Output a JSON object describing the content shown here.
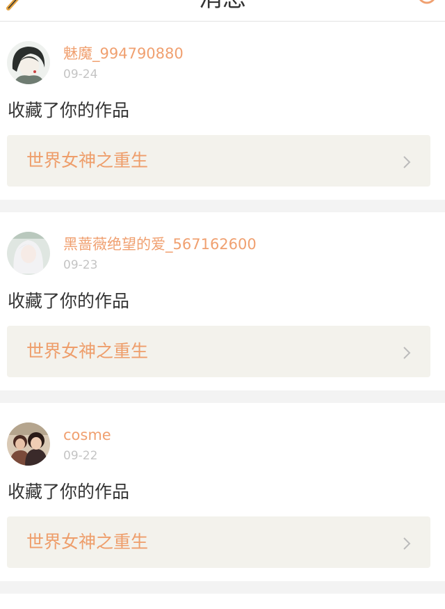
{
  "header": {
    "title": "消息",
    "back_icon": "pencil-icon",
    "action_icon": "search-icon",
    "accent": "#f0a070"
  },
  "notifications": [
    {
      "username": "魅魔_994790880",
      "date": "09-24",
      "action": "收藏了你的作品",
      "work_title": "世界女神之重生",
      "avatar_icon": "anime-girl-avatar"
    },
    {
      "username": "黑蔷薇绝望的爱_567162600",
      "date": "09-23",
      "action": "收藏了你的作品",
      "work_title": "世界女神之重生",
      "avatar_icon": "white-hair-girl-avatar"
    },
    {
      "username": "cosme",
      "date": "09-22",
      "action": "收藏了你的作品",
      "work_title": "世界女神之重生",
      "avatar_icon": "two-women-photo-avatar"
    }
  ],
  "colors": {
    "username": "#f0a070",
    "date": "#c4c4c4",
    "work_title": "#ee9e6b",
    "work_bg": "#f3f2ec",
    "page_bg": "#f3f3f3"
  }
}
